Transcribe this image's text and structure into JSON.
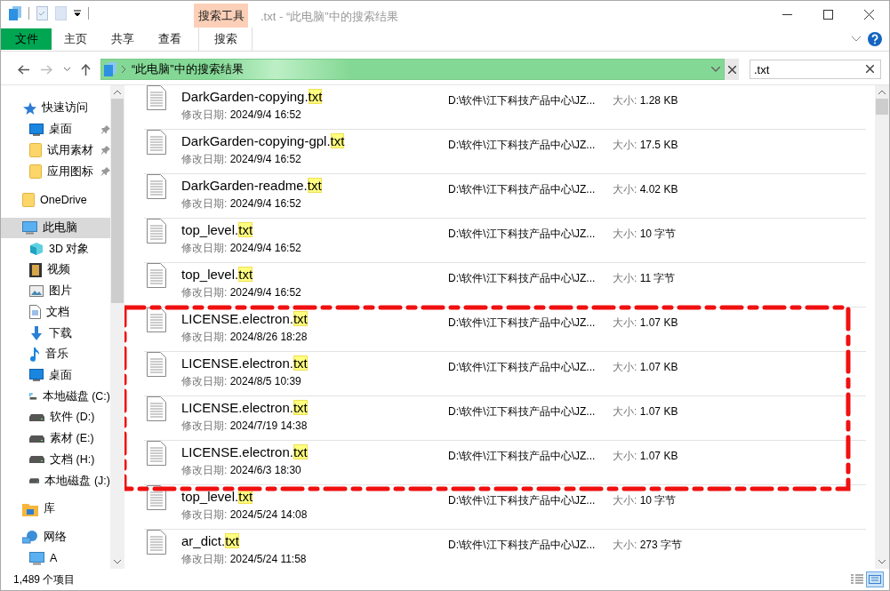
{
  "window": {
    "title": ".txt - “此电脑”中的搜索结果",
    "context_group": "搜索工具"
  },
  "ribbon_tabs": [
    {
      "label": "文件",
      "kind": "file"
    },
    {
      "label": "主页",
      "kind": "normal"
    },
    {
      "label": "共享",
      "kind": "normal"
    },
    {
      "label": "查看",
      "kind": "normal"
    },
    {
      "label": "搜索",
      "kind": "contextual"
    }
  ],
  "address": {
    "path": "“此电脑”中的搜索结果"
  },
  "search": {
    "value": ".txt"
  },
  "sidebar": {
    "items": [
      {
        "label": "快速访问",
        "kind": "star",
        "selected": false,
        "children": [
          {
            "label": "桌面",
            "kind": "desktop",
            "pinned": true,
            "selected": false
          },
          {
            "label": "试用素材",
            "kind": "folder",
            "pinned": true,
            "selected": false
          },
          {
            "label": "应用图标",
            "kind": "folder",
            "pinned": true,
            "selected": false
          }
        ]
      },
      {
        "label": "OneDrive",
        "kind": "folder",
        "selected": false
      },
      {
        "label": "此电脑",
        "kind": "pc",
        "selected": true,
        "children": [
          {
            "label": "3D 对象",
            "kind": "cube",
            "selected": false
          },
          {
            "label": "视频",
            "kind": "video",
            "selected": false
          },
          {
            "label": "图片",
            "kind": "image",
            "selected": false
          },
          {
            "label": "文档",
            "kind": "doc",
            "selected": false
          },
          {
            "label": "下载",
            "kind": "download",
            "selected": false
          },
          {
            "label": "音乐",
            "kind": "music",
            "selected": false
          },
          {
            "label": "桌面",
            "kind": "desktop",
            "selected": false
          },
          {
            "label": "本地磁盘 (C:)",
            "kind": "sysdrive",
            "selected": false
          },
          {
            "label": "软件 (D:)",
            "kind": "drive",
            "selected": false
          },
          {
            "label": "素材 (E:)",
            "kind": "drive",
            "selected": false
          },
          {
            "label": "文档 (H:)",
            "kind": "drive",
            "selected": false
          },
          {
            "label": "本地磁盘 (J:)",
            "kind": "drive",
            "selected": false
          }
        ]
      },
      {
        "label": "库",
        "kind": "library",
        "selected": false
      },
      {
        "label": "网络",
        "kind": "network",
        "selected": false,
        "children": [
          {
            "label": "A",
            "kind": "pc",
            "selected": false
          }
        ]
      }
    ]
  },
  "files": [
    {
      "name": "DarkGarden-copying.",
      "match": "txt",
      "date_label": "修改日期:",
      "date": "2024/9/4 16:52",
      "location": "D:\\软件\\江下科技产品中心\\JZ...",
      "size_label": "大小:",
      "size": "1.28 KB",
      "marked": false
    },
    {
      "name": "DarkGarden-copying-gpl.",
      "match": "txt",
      "date_label": "修改日期:",
      "date": "2024/9/4 16:52",
      "location": "D:\\软件\\江下科技产品中心\\JZ...",
      "size_label": "大小:",
      "size": "17.5 KB",
      "marked": false
    },
    {
      "name": "DarkGarden-readme.",
      "match": "txt",
      "date_label": "修改日期:",
      "date": "2024/9/4 16:52",
      "location": "D:\\软件\\江下科技产品中心\\JZ...",
      "size_label": "大小:",
      "size": "4.02 KB",
      "marked": false
    },
    {
      "name": "top_level.",
      "match": "txt",
      "date_label": "修改日期:",
      "date": "2024/9/4 16:52",
      "location": "D:\\软件\\江下科技产品中心\\JZ...",
      "size_label": "大小:",
      "size": "10 字节",
      "marked": false
    },
    {
      "name": "top_level.",
      "match": "txt",
      "date_label": "修改日期:",
      "date": "2024/9/4 16:52",
      "location": "D:\\软件\\江下科技产品中心\\JZ...",
      "size_label": "大小:",
      "size": "11 字节",
      "marked": false
    },
    {
      "name": "LICENSE.electron.",
      "match": "txt",
      "date_label": "修改日期:",
      "date": "2024/8/26 18:28",
      "location": "D:\\软件\\江下科技产品中心\\JZ...",
      "size_label": "大小:",
      "size": "1.07 KB",
      "marked": true
    },
    {
      "name": "LICENSE.electron.",
      "match": "txt",
      "date_label": "修改日期:",
      "date": "2024/8/5 10:39",
      "location": "D:\\软件\\江下科技产品中心\\JZ...",
      "size_label": "大小:",
      "size": "1.07 KB",
      "marked": true
    },
    {
      "name": "LICENSE.electron.",
      "match": "txt",
      "date_label": "修改日期:",
      "date": "2024/7/19 14:38",
      "location": "D:\\软件\\江下科技产品中心\\JZ...",
      "size_label": "大小:",
      "size": "1.07 KB",
      "marked": true
    },
    {
      "name": "LICENSE.electron.",
      "match": "txt",
      "date_label": "修改日期:",
      "date": "2024/6/3 18:30",
      "location": "D:\\软件\\江下科技产品中心\\JZ...",
      "size_label": "大小:",
      "size": "1.07 KB",
      "marked": true
    },
    {
      "name": "top_level.",
      "match": "txt",
      "date_label": "修改日期:",
      "date": "2024/5/24 14:08",
      "location": "D:\\软件\\江下科技产品中心\\JZ...",
      "size_label": "大小:",
      "size": "10 字节",
      "marked": false
    },
    {
      "name": "ar_dict.",
      "match": "txt",
      "date_label": "修改日期:",
      "date": "2024/5/24 11:58",
      "location": "D:\\软件\\江下科技产品中心\\JZ...",
      "size_label": "大小:",
      "size": "273 字节",
      "marked": false
    }
  ],
  "status_bar": {
    "count": "1,489 个项目",
    "views": [
      {
        "kind": "details",
        "selected": false
      },
      {
        "kind": "tiles",
        "selected": true
      }
    ]
  }
}
